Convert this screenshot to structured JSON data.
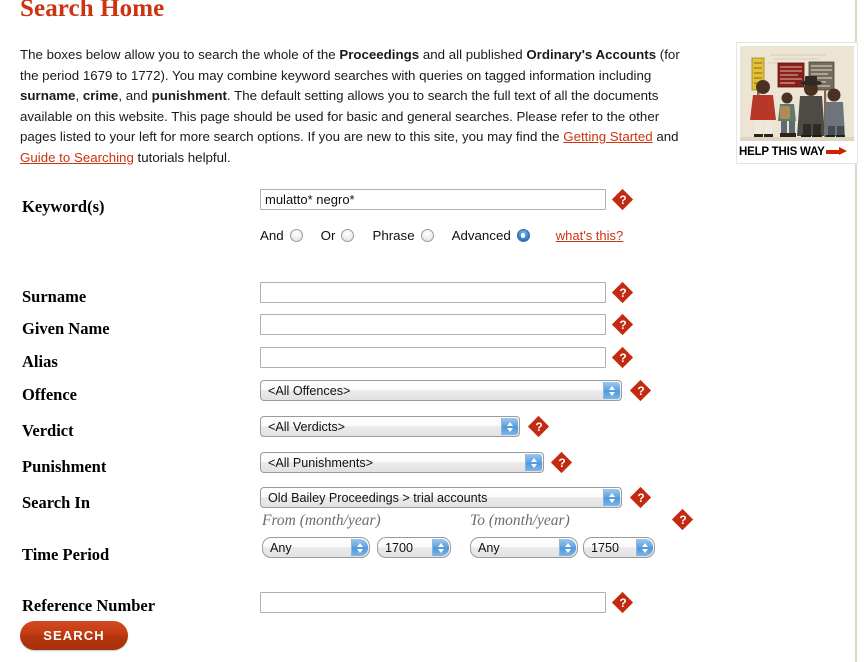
{
  "page": {
    "title": "Search Home"
  },
  "intro": {
    "p1": "The boxes below allow you to search the whole of the ",
    "b1": "Proceedings",
    "p2": " and all published ",
    "b2": "Ordinary's Accounts",
    "p3": " (for the period 1679 to 1772). You may combine keyword searches with queries on tagged information including ",
    "b3": "surname",
    "p4": ", ",
    "b4": "crime",
    "p5": ", and ",
    "b5": "punishment",
    "p6": ". The default setting allows you to search the full text of all the documents available on this website. This page should be used for basic and general searches. Please refer to the other pages listed to your left for more search options. If you are new to this site, you may find the ",
    "link1": "Getting Started",
    "p7": " and ",
    "link2": "Guide to Searching",
    "p8": " tutorials helpful."
  },
  "illustration": {
    "caption": "HELP THIS WAY",
    "arrow_icon": "arrow-right-icon"
  },
  "form": {
    "keyword": {
      "label": "Keyword(s)",
      "value": "mulatto* negro*",
      "placeholder": "",
      "help_icon": "help-question-icon"
    },
    "mode_options": [
      {
        "label": "And",
        "selected": false
      },
      {
        "label": "Or",
        "selected": false
      },
      {
        "label": "Phrase",
        "selected": false
      },
      {
        "label": "Advanced",
        "selected": true
      }
    ],
    "whats_this": "what's this?",
    "surname": {
      "label": "Surname",
      "value": "",
      "placeholder": ""
    },
    "given_name": {
      "label": "Given Name",
      "value": "",
      "placeholder": ""
    },
    "alias": {
      "label": "Alias",
      "value": "",
      "placeholder": ""
    },
    "offence": {
      "label": "Offence",
      "value": "<All Offences>"
    },
    "verdict": {
      "label": "Verdict",
      "value": "<All Verdicts>"
    },
    "punishment": {
      "label": "Punishment",
      "value": "<All Punishments>"
    },
    "search_in": {
      "label": "Search In",
      "value": "Old Bailey Proceedings > trial accounts"
    },
    "time_period": {
      "label": "Time Period",
      "from_header": "From (month/year)",
      "to_header": "To (month/year)",
      "from_month": "Any",
      "from_year": "1700",
      "to_month": "Any",
      "to_year": "1750"
    },
    "reference_number": {
      "label": "Reference Number",
      "value": "",
      "placeholder": ""
    },
    "submit": "SEARCH"
  },
  "colors": {
    "brand_red": "#cc3311",
    "help_red": "#c22a11",
    "button_red": "#c03b12",
    "select_blue": "#5fa3e0",
    "right_rule": "#d6dac6"
  }
}
